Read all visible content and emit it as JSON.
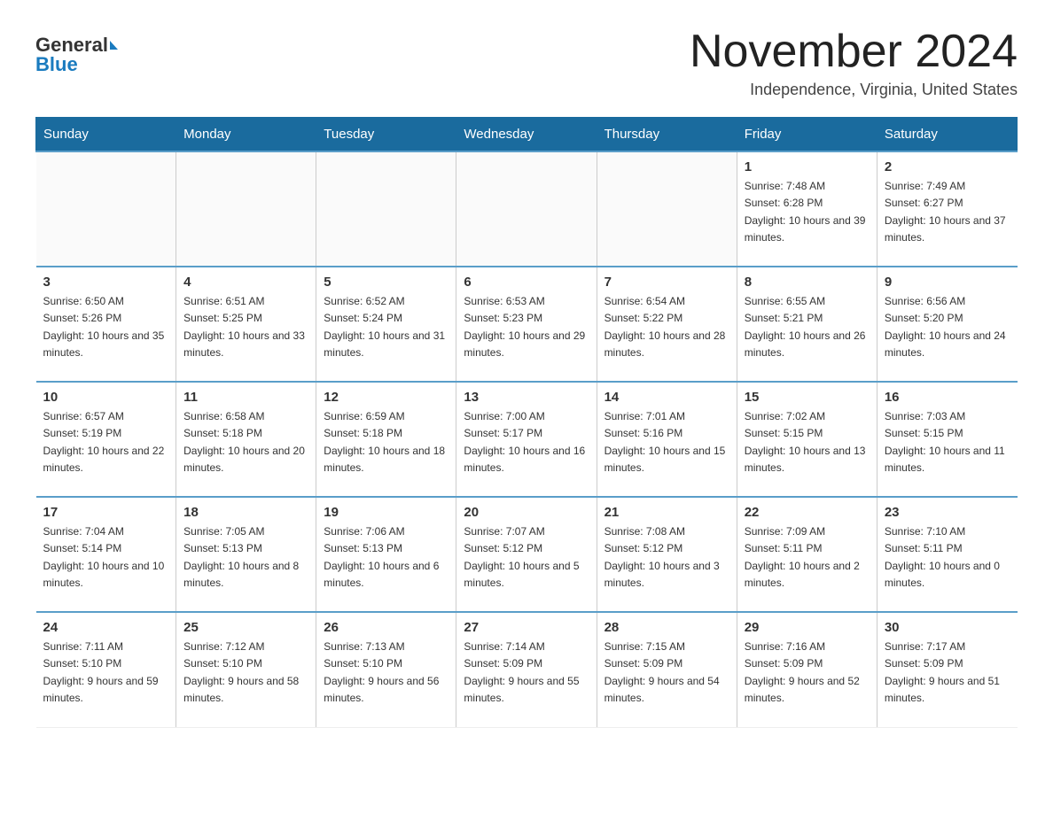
{
  "header": {
    "logo_general": "General",
    "logo_blue": "Blue",
    "month_title": "November 2024",
    "location": "Independence, Virginia, United States"
  },
  "days_of_week": [
    "Sunday",
    "Monday",
    "Tuesday",
    "Wednesday",
    "Thursday",
    "Friday",
    "Saturday"
  ],
  "weeks": [
    [
      {
        "day": "",
        "info": ""
      },
      {
        "day": "",
        "info": ""
      },
      {
        "day": "",
        "info": ""
      },
      {
        "day": "",
        "info": ""
      },
      {
        "day": "",
        "info": ""
      },
      {
        "day": "1",
        "info": "Sunrise: 7:48 AM\nSunset: 6:28 PM\nDaylight: 10 hours and 39 minutes."
      },
      {
        "day": "2",
        "info": "Sunrise: 7:49 AM\nSunset: 6:27 PM\nDaylight: 10 hours and 37 minutes."
      }
    ],
    [
      {
        "day": "3",
        "info": "Sunrise: 6:50 AM\nSunset: 5:26 PM\nDaylight: 10 hours and 35 minutes."
      },
      {
        "day": "4",
        "info": "Sunrise: 6:51 AM\nSunset: 5:25 PM\nDaylight: 10 hours and 33 minutes."
      },
      {
        "day": "5",
        "info": "Sunrise: 6:52 AM\nSunset: 5:24 PM\nDaylight: 10 hours and 31 minutes."
      },
      {
        "day": "6",
        "info": "Sunrise: 6:53 AM\nSunset: 5:23 PM\nDaylight: 10 hours and 29 minutes."
      },
      {
        "day": "7",
        "info": "Sunrise: 6:54 AM\nSunset: 5:22 PM\nDaylight: 10 hours and 28 minutes."
      },
      {
        "day": "8",
        "info": "Sunrise: 6:55 AM\nSunset: 5:21 PM\nDaylight: 10 hours and 26 minutes."
      },
      {
        "day": "9",
        "info": "Sunrise: 6:56 AM\nSunset: 5:20 PM\nDaylight: 10 hours and 24 minutes."
      }
    ],
    [
      {
        "day": "10",
        "info": "Sunrise: 6:57 AM\nSunset: 5:19 PM\nDaylight: 10 hours and 22 minutes."
      },
      {
        "day": "11",
        "info": "Sunrise: 6:58 AM\nSunset: 5:18 PM\nDaylight: 10 hours and 20 minutes."
      },
      {
        "day": "12",
        "info": "Sunrise: 6:59 AM\nSunset: 5:18 PM\nDaylight: 10 hours and 18 minutes."
      },
      {
        "day": "13",
        "info": "Sunrise: 7:00 AM\nSunset: 5:17 PM\nDaylight: 10 hours and 16 minutes."
      },
      {
        "day": "14",
        "info": "Sunrise: 7:01 AM\nSunset: 5:16 PM\nDaylight: 10 hours and 15 minutes."
      },
      {
        "day": "15",
        "info": "Sunrise: 7:02 AM\nSunset: 5:15 PM\nDaylight: 10 hours and 13 minutes."
      },
      {
        "day": "16",
        "info": "Sunrise: 7:03 AM\nSunset: 5:15 PM\nDaylight: 10 hours and 11 minutes."
      }
    ],
    [
      {
        "day": "17",
        "info": "Sunrise: 7:04 AM\nSunset: 5:14 PM\nDaylight: 10 hours and 10 minutes."
      },
      {
        "day": "18",
        "info": "Sunrise: 7:05 AM\nSunset: 5:13 PM\nDaylight: 10 hours and 8 minutes."
      },
      {
        "day": "19",
        "info": "Sunrise: 7:06 AM\nSunset: 5:13 PM\nDaylight: 10 hours and 6 minutes."
      },
      {
        "day": "20",
        "info": "Sunrise: 7:07 AM\nSunset: 5:12 PM\nDaylight: 10 hours and 5 minutes."
      },
      {
        "day": "21",
        "info": "Sunrise: 7:08 AM\nSunset: 5:12 PM\nDaylight: 10 hours and 3 minutes."
      },
      {
        "day": "22",
        "info": "Sunrise: 7:09 AM\nSunset: 5:11 PM\nDaylight: 10 hours and 2 minutes."
      },
      {
        "day": "23",
        "info": "Sunrise: 7:10 AM\nSunset: 5:11 PM\nDaylight: 10 hours and 0 minutes."
      }
    ],
    [
      {
        "day": "24",
        "info": "Sunrise: 7:11 AM\nSunset: 5:10 PM\nDaylight: 9 hours and 59 minutes."
      },
      {
        "day": "25",
        "info": "Sunrise: 7:12 AM\nSunset: 5:10 PM\nDaylight: 9 hours and 58 minutes."
      },
      {
        "day": "26",
        "info": "Sunrise: 7:13 AM\nSunset: 5:10 PM\nDaylight: 9 hours and 56 minutes."
      },
      {
        "day": "27",
        "info": "Sunrise: 7:14 AM\nSunset: 5:09 PM\nDaylight: 9 hours and 55 minutes."
      },
      {
        "day": "28",
        "info": "Sunrise: 7:15 AM\nSunset: 5:09 PM\nDaylight: 9 hours and 54 minutes."
      },
      {
        "day": "29",
        "info": "Sunrise: 7:16 AM\nSunset: 5:09 PM\nDaylight: 9 hours and 52 minutes."
      },
      {
        "day": "30",
        "info": "Sunrise: 7:17 AM\nSunset: 5:09 PM\nDaylight: 9 hours and 51 minutes."
      }
    ]
  ]
}
